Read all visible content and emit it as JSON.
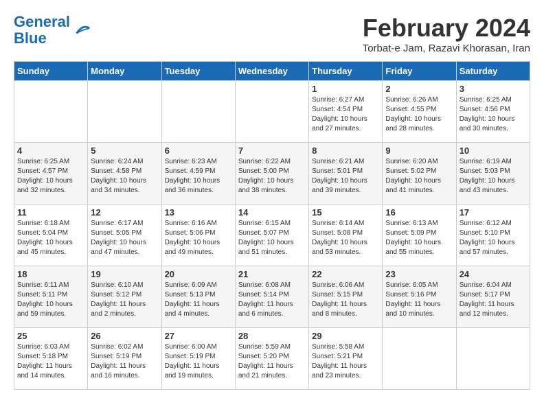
{
  "header": {
    "logo_line1": "General",
    "logo_line2": "Blue",
    "month_title": "February 2024",
    "subtitle": "Torbat-e Jam, Razavi Khorasan, Iran"
  },
  "days_of_week": [
    "Sunday",
    "Monday",
    "Tuesday",
    "Wednesday",
    "Thursday",
    "Friday",
    "Saturday"
  ],
  "weeks": [
    [
      {
        "day": "",
        "info": ""
      },
      {
        "day": "",
        "info": ""
      },
      {
        "day": "",
        "info": ""
      },
      {
        "day": "",
        "info": ""
      },
      {
        "day": "1",
        "info": "Sunrise: 6:27 AM\nSunset: 4:54 PM\nDaylight: 10 hours and 27 minutes."
      },
      {
        "day": "2",
        "info": "Sunrise: 6:26 AM\nSunset: 4:55 PM\nDaylight: 10 hours and 28 minutes."
      },
      {
        "day": "3",
        "info": "Sunrise: 6:25 AM\nSunset: 4:56 PM\nDaylight: 10 hours and 30 minutes."
      }
    ],
    [
      {
        "day": "4",
        "info": "Sunrise: 6:25 AM\nSunset: 4:57 PM\nDaylight: 10 hours and 32 minutes."
      },
      {
        "day": "5",
        "info": "Sunrise: 6:24 AM\nSunset: 4:58 PM\nDaylight: 10 hours and 34 minutes."
      },
      {
        "day": "6",
        "info": "Sunrise: 6:23 AM\nSunset: 4:59 PM\nDaylight: 10 hours and 36 minutes."
      },
      {
        "day": "7",
        "info": "Sunrise: 6:22 AM\nSunset: 5:00 PM\nDaylight: 10 hours and 38 minutes."
      },
      {
        "day": "8",
        "info": "Sunrise: 6:21 AM\nSunset: 5:01 PM\nDaylight: 10 hours and 39 minutes."
      },
      {
        "day": "9",
        "info": "Sunrise: 6:20 AM\nSunset: 5:02 PM\nDaylight: 10 hours and 41 minutes."
      },
      {
        "day": "10",
        "info": "Sunrise: 6:19 AM\nSunset: 5:03 PM\nDaylight: 10 hours and 43 minutes."
      }
    ],
    [
      {
        "day": "11",
        "info": "Sunrise: 6:18 AM\nSunset: 5:04 PM\nDaylight: 10 hours and 45 minutes."
      },
      {
        "day": "12",
        "info": "Sunrise: 6:17 AM\nSunset: 5:05 PM\nDaylight: 10 hours and 47 minutes."
      },
      {
        "day": "13",
        "info": "Sunrise: 6:16 AM\nSunset: 5:06 PM\nDaylight: 10 hours and 49 minutes."
      },
      {
        "day": "14",
        "info": "Sunrise: 6:15 AM\nSunset: 5:07 PM\nDaylight: 10 hours and 51 minutes."
      },
      {
        "day": "15",
        "info": "Sunrise: 6:14 AM\nSunset: 5:08 PM\nDaylight: 10 hours and 53 minutes."
      },
      {
        "day": "16",
        "info": "Sunrise: 6:13 AM\nSunset: 5:09 PM\nDaylight: 10 hours and 55 minutes."
      },
      {
        "day": "17",
        "info": "Sunrise: 6:12 AM\nSunset: 5:10 PM\nDaylight: 10 hours and 57 minutes."
      }
    ],
    [
      {
        "day": "18",
        "info": "Sunrise: 6:11 AM\nSunset: 5:11 PM\nDaylight: 10 hours and 59 minutes."
      },
      {
        "day": "19",
        "info": "Sunrise: 6:10 AM\nSunset: 5:12 PM\nDaylight: 11 hours and 2 minutes."
      },
      {
        "day": "20",
        "info": "Sunrise: 6:09 AM\nSunset: 5:13 PM\nDaylight: 11 hours and 4 minutes."
      },
      {
        "day": "21",
        "info": "Sunrise: 6:08 AM\nSunset: 5:14 PM\nDaylight: 11 hours and 6 minutes."
      },
      {
        "day": "22",
        "info": "Sunrise: 6:06 AM\nSunset: 5:15 PM\nDaylight: 11 hours and 8 minutes."
      },
      {
        "day": "23",
        "info": "Sunrise: 6:05 AM\nSunset: 5:16 PM\nDaylight: 11 hours and 10 minutes."
      },
      {
        "day": "24",
        "info": "Sunrise: 6:04 AM\nSunset: 5:17 PM\nDaylight: 11 hours and 12 minutes."
      }
    ],
    [
      {
        "day": "25",
        "info": "Sunrise: 6:03 AM\nSunset: 5:18 PM\nDaylight: 11 hours and 14 minutes."
      },
      {
        "day": "26",
        "info": "Sunrise: 6:02 AM\nSunset: 5:19 PM\nDaylight: 11 hours and 16 minutes."
      },
      {
        "day": "27",
        "info": "Sunrise: 6:00 AM\nSunset: 5:19 PM\nDaylight: 11 hours and 19 minutes."
      },
      {
        "day": "28",
        "info": "Sunrise: 5:59 AM\nSunset: 5:20 PM\nDaylight: 11 hours and 21 minutes."
      },
      {
        "day": "29",
        "info": "Sunrise: 5:58 AM\nSunset: 5:21 PM\nDaylight: 11 hours and 23 minutes."
      },
      {
        "day": "",
        "info": ""
      },
      {
        "day": "",
        "info": ""
      }
    ]
  ]
}
